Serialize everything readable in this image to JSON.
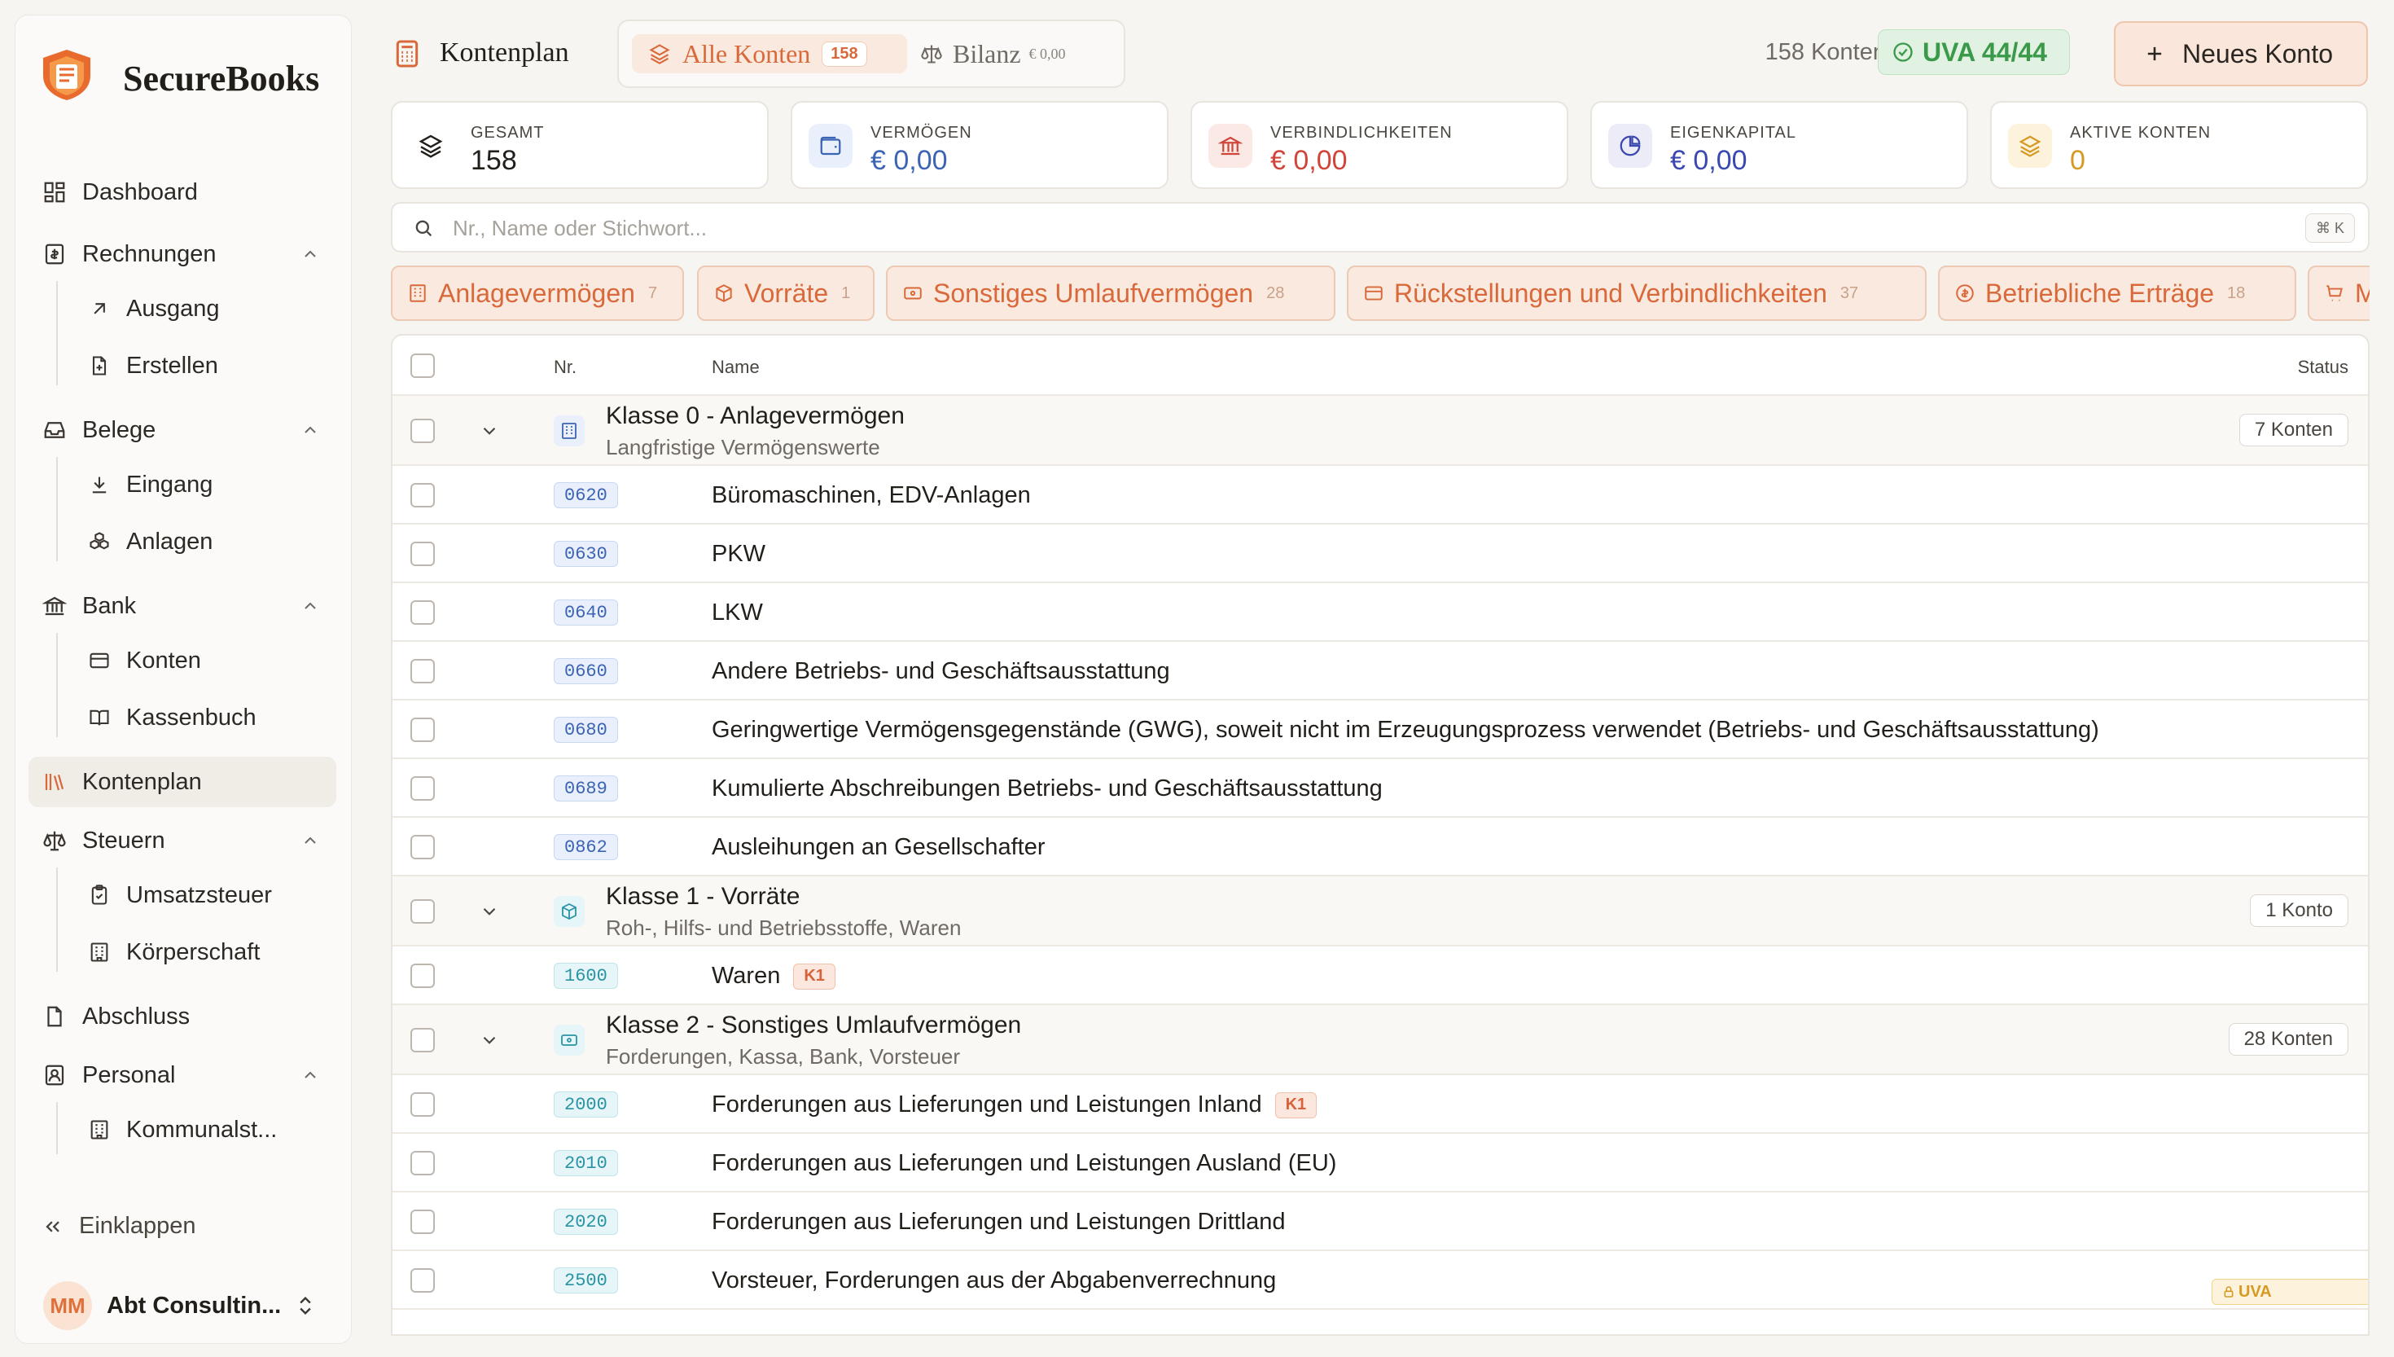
{
  "app": {
    "name": "SecureBooks"
  },
  "sidebar": {
    "items": [
      {
        "label": "Dashboard"
      },
      {
        "label": "Rechnungen"
      },
      {
        "label": "Ausgang"
      },
      {
        "label": "Erstellen"
      },
      {
        "label": "Belege"
      },
      {
        "label": "Eingang"
      },
      {
        "label": "Anlagen"
      },
      {
        "label": "Bank"
      },
      {
        "label": "Konten"
      },
      {
        "label": "Kassenbuch"
      },
      {
        "label": "Kontenplan"
      },
      {
        "label": "Steuern"
      },
      {
        "label": "Umsatzsteuer"
      },
      {
        "label": "Körperschaft"
      },
      {
        "label": "Abschluss"
      },
      {
        "label": "Personal"
      },
      {
        "label": "Kommunalst..."
      }
    ],
    "collapse_label": "Einklappen",
    "user": {
      "initials": "MM",
      "name": "Abt Consultin..."
    }
  },
  "header": {
    "title": "Kontenplan",
    "tabs": [
      {
        "label": "Alle Konten",
        "badge": "158"
      },
      {
        "label": "Bilanz",
        "badge": "€ 0,00"
      }
    ],
    "count_text": "158 Konten",
    "uva_label": "UVA 44/44",
    "new_button": "Neues Konto"
  },
  "stats": [
    {
      "label": "GESAMT",
      "value": "158",
      "color": "#221f1b"
    },
    {
      "label": "VERMÖGEN",
      "value": "€ 0,00",
      "color": "#3c64b4"
    },
    {
      "label": "VERBINDLICHKEITEN",
      "value": "€ 0,00",
      "color": "#d0453a"
    },
    {
      "label": "EIGENKAPITAL",
      "value": "€ 0,00",
      "color": "#3a48b0"
    },
    {
      "label": "AKTIVE KONTEN",
      "value": "0",
      "color": "#d69a24"
    }
  ],
  "search": {
    "placeholder": "Nr., Name oder Stichwort...",
    "shortcut": "⌘ K"
  },
  "filters": [
    {
      "label": "Anlagevermögen",
      "count": "7"
    },
    {
      "label": "Vorräte",
      "count": "1"
    },
    {
      "label": "Sonstiges Umlaufvermögen",
      "count": "28"
    },
    {
      "label": "Rückstellungen und Verbindlichkeiten",
      "count": "37"
    },
    {
      "label": "Betriebliche Erträge",
      "count": "18"
    },
    {
      "label": "Mate",
      "count": ""
    }
  ],
  "table": {
    "columns": {
      "nr": "Nr.",
      "name": "Name",
      "status": "Status"
    },
    "groups": [
      {
        "title": "Klasse 0 - Anlagevermögen",
        "subtitle": "Langfristige Vermögenswerte",
        "count": "7 Konten"
      },
      {
        "title": "Klasse 1 - Vorräte",
        "subtitle": "Roh-, Hilfs- und Betriebsstoffe, Waren",
        "count": "1 Konto"
      },
      {
        "title": "Klasse 2 - Sonstiges Umlaufvermögen",
        "subtitle": "Forderungen, Kassa, Bank, Vorsteuer",
        "count": "28 Konten"
      }
    ],
    "rows": [
      {
        "nr": "0620",
        "name": "Büromaschinen, EDV-Anlagen"
      },
      {
        "nr": "0630",
        "name": "PKW"
      },
      {
        "nr": "0640",
        "name": "LKW"
      },
      {
        "nr": "0660",
        "name": "Andere Betriebs- und Geschäftsausstattung"
      },
      {
        "nr": "0680",
        "name": "Geringwertige Vermögensgegenstände (GWG), soweit nicht im Erzeugungsprozess verwendet (Betriebs- und Geschäftsausstattung)"
      },
      {
        "nr": "0689",
        "name": "Kumulierte Abschreibungen Betriebs- und Geschäftsausstattung"
      },
      {
        "nr": "0862",
        "name": "Ausleihungen an Gesellschafter"
      },
      {
        "nr": "1600",
        "name": "Waren",
        "tag": "K1"
      },
      {
        "nr": "2000",
        "name": "Forderungen aus Lieferungen und Leistungen Inland",
        "tag": "K1"
      },
      {
        "nr": "2010",
        "name": "Forderungen aus Lieferungen und Leistungen Ausland (EU)"
      },
      {
        "nr": "2020",
        "name": "Forderungen aus Lieferungen und Leistungen Drittland"
      },
      {
        "nr": "2500",
        "name": "Vorsteuer, Forderungen aus der Abgabenverrechnung",
        "tag": "UVA"
      }
    ]
  },
  "colors": {
    "accent": "#d9693a",
    "blue": "#3c64b4",
    "green": "#3a9a4a"
  }
}
